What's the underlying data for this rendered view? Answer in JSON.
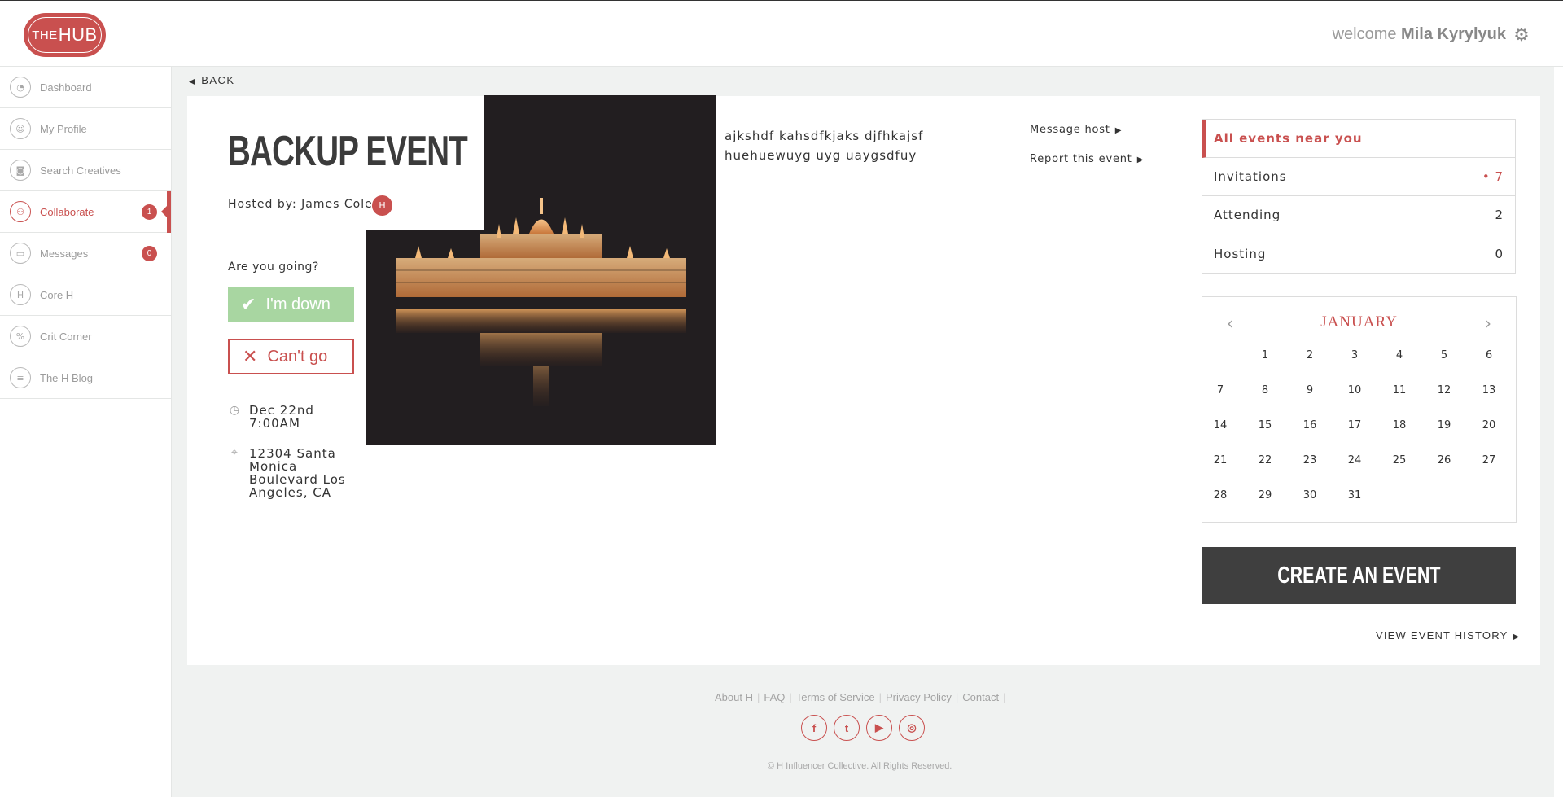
{
  "header": {
    "logo_text_small": "THE",
    "logo_text_big": "HUB",
    "welcome_prefix": "welcome",
    "user_name": "Mila Kyrylyuk",
    "settings_icon": "gear-icon"
  },
  "sidebar": {
    "items": [
      {
        "label": "Dashboard",
        "icon": "dashboard-icon",
        "glyph": "◔"
      },
      {
        "label": "My Profile",
        "icon": "profile-icon",
        "glyph": "☺"
      },
      {
        "label": "Search Creatives",
        "icon": "camera-icon",
        "glyph": "◙"
      },
      {
        "label": "Collaborate",
        "icon": "collaborate-icon",
        "glyph": "⚇",
        "badge": "1",
        "active": true
      },
      {
        "label": "Messages",
        "icon": "messages-icon",
        "glyph": "▭",
        "badge": "0"
      },
      {
        "label": "Core H",
        "icon": "core-h-icon",
        "glyph": "H"
      },
      {
        "label": "Crit Corner",
        "icon": "crit-corner-icon",
        "glyph": "%"
      },
      {
        "label": "The H Blog",
        "icon": "blog-icon",
        "glyph": "≡"
      }
    ]
  },
  "back_label": "BACK",
  "event": {
    "title": "BACKUP EVENT",
    "hosted_by": "Hosted by: James Cole",
    "host_avatar_text": "H",
    "rsvp_question": "Are you going?",
    "going_label": "I'm down",
    "not_going_label": "Can't go",
    "date": "Dec 22nd",
    "time": "7:00AM",
    "address_line1": "12304 Santa",
    "address_line2": "Monica",
    "address_line3": "Boulevard Los",
    "address_line4": "Angeles, CA",
    "description_line1": "ajkshdf kahsdfkjaks djfhkajsf",
    "description_line2": "huehuewuyg uyg uaygsdfuy",
    "message_host": "Message host",
    "report_event": "Report this event"
  },
  "filters": {
    "items": [
      {
        "label": "All events near you",
        "count": "",
        "active": true
      },
      {
        "label": "Invitations",
        "count": "• 7",
        "highlight": true
      },
      {
        "label": "Attending",
        "count": "2"
      },
      {
        "label": "Hosting",
        "count": "0"
      }
    ]
  },
  "calendar": {
    "month": "JANUARY",
    "prev_icon": "chevron-left-icon",
    "next_icon": "chevron-right-icon",
    "weeks": [
      [
        "",
        "1",
        "2",
        "3",
        "4",
        "5",
        "6"
      ],
      [
        "7",
        "8",
        "9",
        "10",
        "11",
        "12",
        "13"
      ],
      [
        "14",
        "15",
        "16",
        "17",
        "18",
        "19",
        "20"
      ],
      [
        "21",
        "22",
        "23",
        "24",
        "25",
        "26",
        "27"
      ],
      [
        "28",
        "29",
        "30",
        "31",
        "",
        "",
        ""
      ]
    ]
  },
  "create_event_label": "CREATE AN EVENT",
  "view_history_label": "VIEW EVENT HISTORY",
  "footer": {
    "links": [
      "About H",
      "FAQ",
      "Terms of Service",
      "Privacy Policy",
      "Contact"
    ],
    "social": [
      {
        "name": "facebook-icon",
        "glyph": "f"
      },
      {
        "name": "twitter-icon",
        "glyph": "t"
      },
      {
        "name": "youtube-icon",
        "glyph": "▶"
      },
      {
        "name": "instagram-icon",
        "glyph": "◎"
      }
    ],
    "copyright": "© H Influencer Collective. All Rights Reserved."
  },
  "colors": {
    "accent": "#c9504f",
    "going_green": "#a8d6a1",
    "dark_button": "#3f3f3f",
    "background": "#f0f2f1"
  }
}
